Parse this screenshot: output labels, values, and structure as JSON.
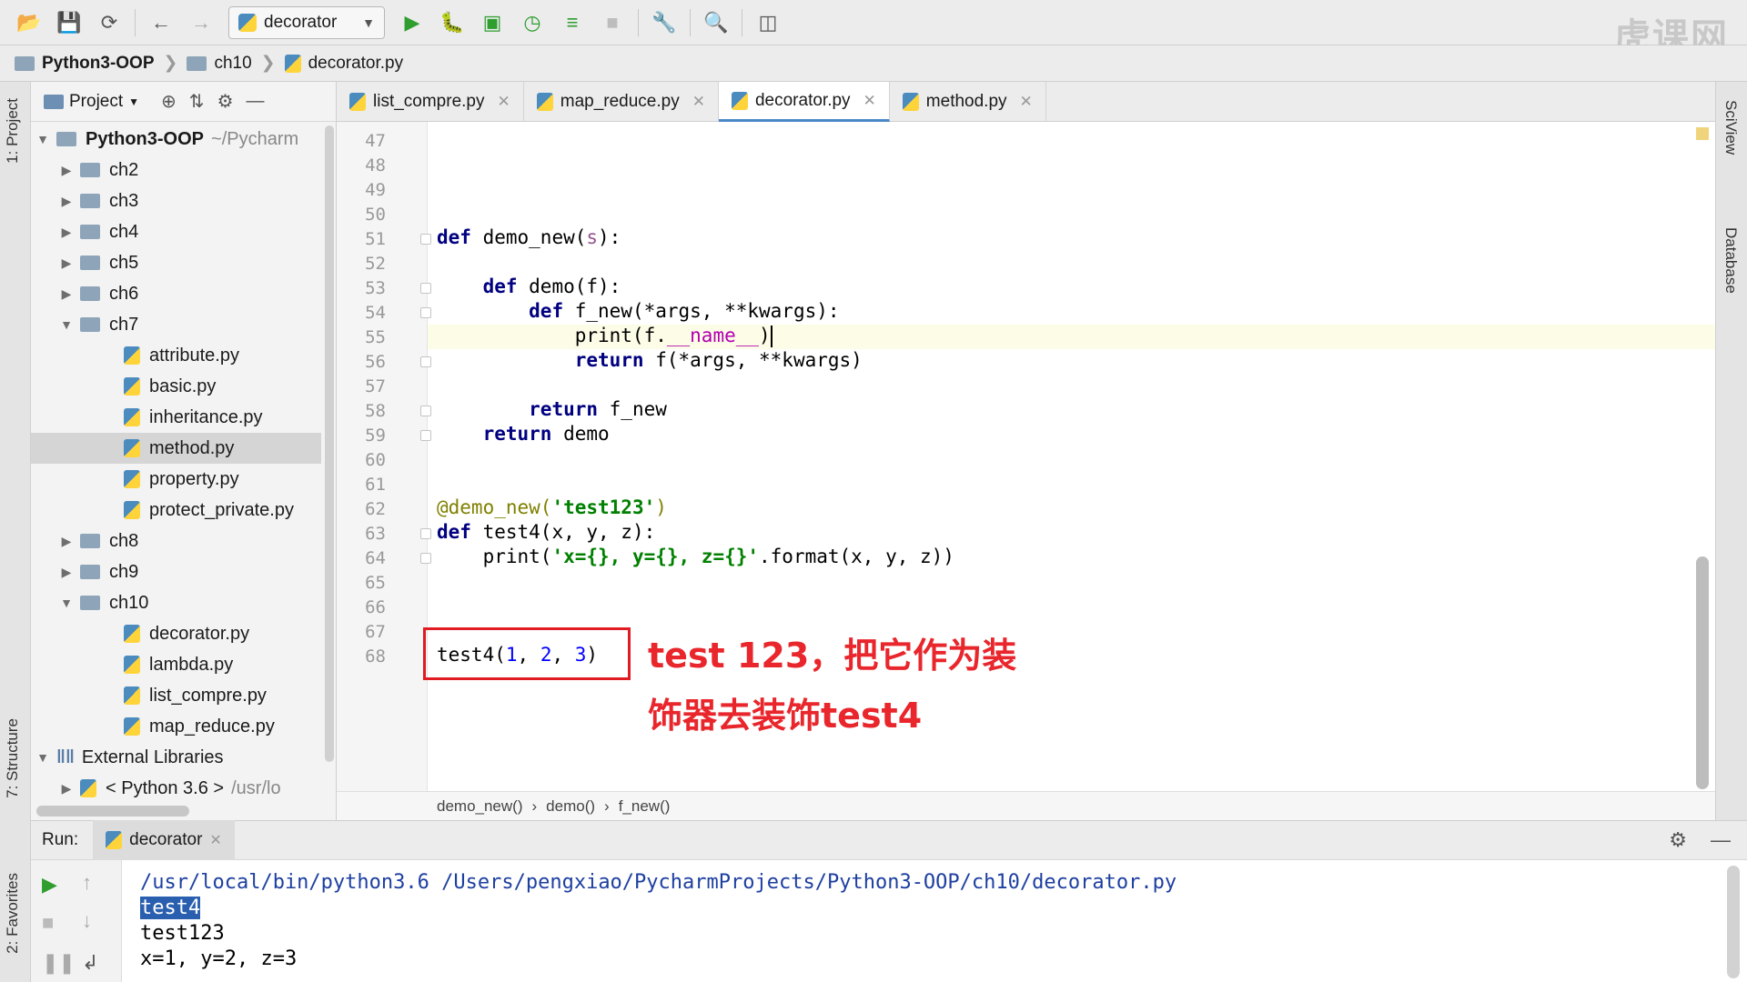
{
  "toolbar": {
    "run_config": "decorator",
    "watermark": "虎课网"
  },
  "breadcrumb": {
    "project": "Python3-OOP",
    "folder": "ch10",
    "file": "decorator.py"
  },
  "left_stripe": {
    "project_tab": "1: Project",
    "structure_tab": "7: Structure",
    "favorites_tab": "2: Favorites"
  },
  "project_panel": {
    "title": "Project",
    "root": {
      "name": "Python3-OOP",
      "path": "~/Pycharm"
    },
    "items": [
      {
        "label": "ch2"
      },
      {
        "label": "ch3"
      },
      {
        "label": "ch4"
      },
      {
        "label": "ch5"
      },
      {
        "label": "ch6"
      },
      {
        "label": "ch7"
      },
      {
        "label": "attribute.py"
      },
      {
        "label": "basic.py"
      },
      {
        "label": "inheritance.py"
      },
      {
        "label": "method.py"
      },
      {
        "label": "property.py"
      },
      {
        "label": "protect_private.py"
      },
      {
        "label": "ch8"
      },
      {
        "label": "ch9"
      },
      {
        "label": "ch10"
      },
      {
        "label": "decorator.py"
      },
      {
        "label": "lambda.py"
      },
      {
        "label": "list_compre.py"
      },
      {
        "label": "map_reduce.py"
      },
      {
        "label": "External Libraries"
      },
      {
        "label": "< Python 3.6 >",
        "path": "/usr/lo"
      }
    ]
  },
  "editor_tabs": [
    {
      "label": "list_compre.py"
    },
    {
      "label": "map_reduce.py"
    },
    {
      "label": "decorator.py"
    },
    {
      "label": "method.py"
    }
  ],
  "editor": {
    "line_numbers": [
      "47",
      "48",
      "49",
      "50",
      "51",
      "52",
      "53",
      "54",
      "55",
      "56",
      "57",
      "58",
      "59",
      "60",
      "61",
      "62",
      "63",
      "64",
      "65",
      "66",
      "67",
      "68"
    ],
    "current_line": "55",
    "code_breadcrumbs": [
      "demo_new()",
      "demo()",
      "f_new()"
    ]
  },
  "annotation": {
    "line1": "test 123，把它作为装",
    "line2": "饰器去装饰test4"
  },
  "right_stripe": {
    "sciview": "SciView",
    "database": "Database"
  },
  "run_panel": {
    "label": "Run:",
    "tab": "decorator",
    "output": [
      "/usr/local/bin/python3.6 /Users/pengxiao/PycharmProjects/Python3-OOP/ch10/decorator.py",
      "test4",
      "test123",
      "x=1, y=2, z=3"
    ]
  }
}
